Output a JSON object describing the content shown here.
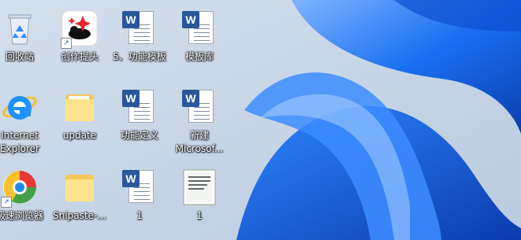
{
  "desktop": {
    "top_partial_label": "...",
    "icons": [
      {
        "label": "回收站",
        "type": "recycle-bin"
      },
      {
        "label": "创作提头",
        "type": "app-shortcut"
      },
      {
        "label": "5、功能模板",
        "type": "word-doc"
      },
      {
        "label": "模板库",
        "type": "word-doc"
      },
      {
        "label": "Internet Explorer",
        "type": "internet-explorer"
      },
      {
        "label": "update",
        "type": "folder"
      },
      {
        "label": "功能定义",
        "type": "word-doc"
      },
      {
        "label": "新建 Microsof...",
        "type": "word-doc"
      },
      {
        "label": "极速浏览器",
        "type": "browser-shortcut"
      },
      {
        "label": "Snipaste-...",
        "type": "folder"
      },
      {
        "label": "1",
        "type": "word-doc"
      },
      {
        "label": "1",
        "type": "image-file"
      }
    ]
  },
  "colors": {
    "wallpaper_light": "#c9d6e6",
    "wallpaper_blue": "#1669e6",
    "word_blue": "#2b579a",
    "folder_yellow": "#f3c75a"
  }
}
